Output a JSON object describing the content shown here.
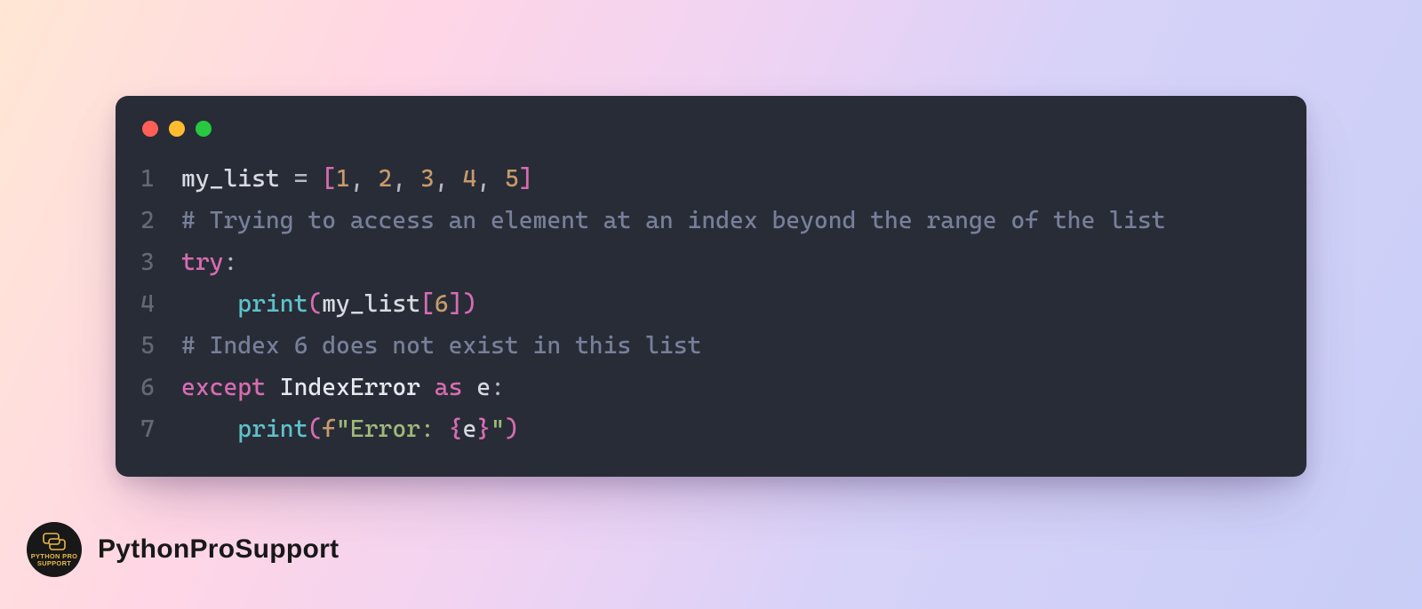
{
  "code": {
    "lines": [
      {
        "n": "1",
        "tokens": [
          {
            "t": "my_list ",
            "c": "var"
          },
          {
            "t": "=",
            "c": "pun"
          },
          {
            "t": " ",
            "c": "var"
          },
          {
            "t": "[",
            "c": "brk"
          },
          {
            "t": "1",
            "c": "num"
          },
          {
            "t": ", ",
            "c": "pun"
          },
          {
            "t": "2",
            "c": "num"
          },
          {
            "t": ", ",
            "c": "pun"
          },
          {
            "t": "3",
            "c": "num"
          },
          {
            "t": ", ",
            "c": "pun"
          },
          {
            "t": "4",
            "c": "num"
          },
          {
            "t": ", ",
            "c": "pun"
          },
          {
            "t": "5",
            "c": "num"
          },
          {
            "t": "]",
            "c": "brk"
          }
        ]
      },
      {
        "n": "2",
        "tokens": [
          {
            "t": "# Trying to access an element at an index beyond the range of the list",
            "c": "cmt"
          }
        ]
      },
      {
        "n": "3",
        "tokens": [
          {
            "t": "try",
            "c": "kw"
          },
          {
            "t": ":",
            "c": "pun"
          }
        ]
      },
      {
        "n": "4",
        "tokens": [
          {
            "t": "    ",
            "c": "var"
          },
          {
            "t": "print",
            "c": "fn"
          },
          {
            "t": "(",
            "c": "brk"
          },
          {
            "t": "my_list",
            "c": "var"
          },
          {
            "t": "[",
            "c": "brk"
          },
          {
            "t": "6",
            "c": "num"
          },
          {
            "t": "]",
            "c": "brk"
          },
          {
            "t": ")",
            "c": "brk"
          }
        ]
      },
      {
        "n": "5",
        "tokens": [
          {
            "t": "# Index 6 does not exist in this list",
            "c": "cmt"
          }
        ]
      },
      {
        "n": "6",
        "tokens": [
          {
            "t": "except",
            "c": "kw"
          },
          {
            "t": " ",
            "c": "var"
          },
          {
            "t": "IndexError",
            "c": "typ"
          },
          {
            "t": " ",
            "c": "var"
          },
          {
            "t": "as",
            "c": "kw"
          },
          {
            "t": " e",
            "c": "var"
          },
          {
            "t": ":",
            "c": "pun"
          }
        ]
      },
      {
        "n": "7",
        "tokens": [
          {
            "t": "    ",
            "c": "var"
          },
          {
            "t": "print",
            "c": "fn"
          },
          {
            "t": "(",
            "c": "brk"
          },
          {
            "t": "f",
            "c": "fstr"
          },
          {
            "t": "\"Error: ",
            "c": "str"
          },
          {
            "t": "{",
            "c": "brk"
          },
          {
            "t": "e",
            "c": "var"
          },
          {
            "t": "}",
            "c": "brk"
          },
          {
            "t": "\"",
            "c": "str"
          },
          {
            "t": ")",
            "c": "brk"
          }
        ]
      }
    ]
  },
  "footer": {
    "badge_line1": "PYTHON PRO",
    "badge_line2": "SUPPORT",
    "brand": "PythonProSupport"
  }
}
